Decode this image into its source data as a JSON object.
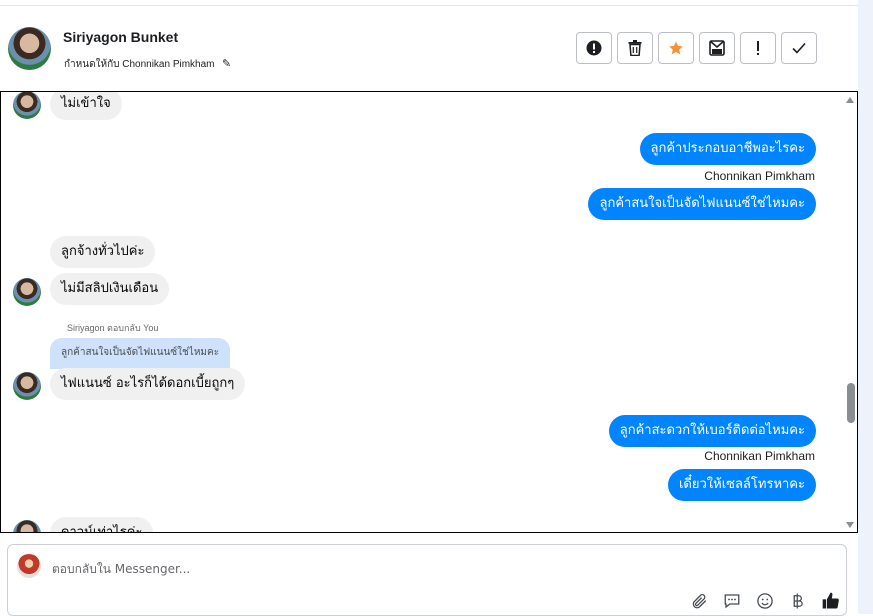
{
  "header": {
    "name": "Siriyagon Bunket",
    "assigned_text": "กำหนดให้กับ Chonnikan Pimkham",
    "actions": [
      {
        "icon": "alert-circle-icon"
      },
      {
        "icon": "trash-icon"
      },
      {
        "icon": "star-icon",
        "color": "#f7923b"
      },
      {
        "icon": "mark-unread-icon"
      },
      {
        "icon": "exclamation-icon"
      },
      {
        "icon": "check-icon"
      }
    ]
  },
  "messages": {
    "m1": "ไม่เข้าใจ",
    "m2": "ลูกค้าประกอบอาชีพอะไรคะ",
    "sender1": "Chonnikan Pimkham",
    "m3": "ลูกค้าสนใจเป็นจัดไฟแนนซ์ใช่ไหมคะ",
    "m4": "ลูกจ้างทั่วไปค่ะ",
    "m5": "ไม่มีสลิปเงินเดือน",
    "reply_hint": "Siriyagon ตอบกลับ You",
    "quoted": "ลูกค้าสนใจเป็นจัดไฟแนนซ์ใช่ไหมคะ",
    "m6": "ไฟแนนซ์ อะไรก็ได้ดอกเบี้ยถูกๆ",
    "m7": "ลูกค้าสะดวกให้เบอร์ติดต่อไหมคะ",
    "sender2": "Chonnikan Pimkham",
    "m8": "เดี๋ยวให้เซลล์โทรหาคะ",
    "m9": "ดาวน์เท่าไรค่ะ"
  },
  "colors": {
    "outgoing_bubble": "#0084ff",
    "incoming_bubble": "#f0f0f0",
    "quoted_bubble": "#cfe2fb"
  },
  "composer": {
    "placeholder": "ตอบกลับใน Messenger...",
    "tools": [
      "attachment-icon",
      "saved-reply-icon",
      "emoji-icon",
      "baht-icon",
      "thumbs-up-icon"
    ]
  }
}
